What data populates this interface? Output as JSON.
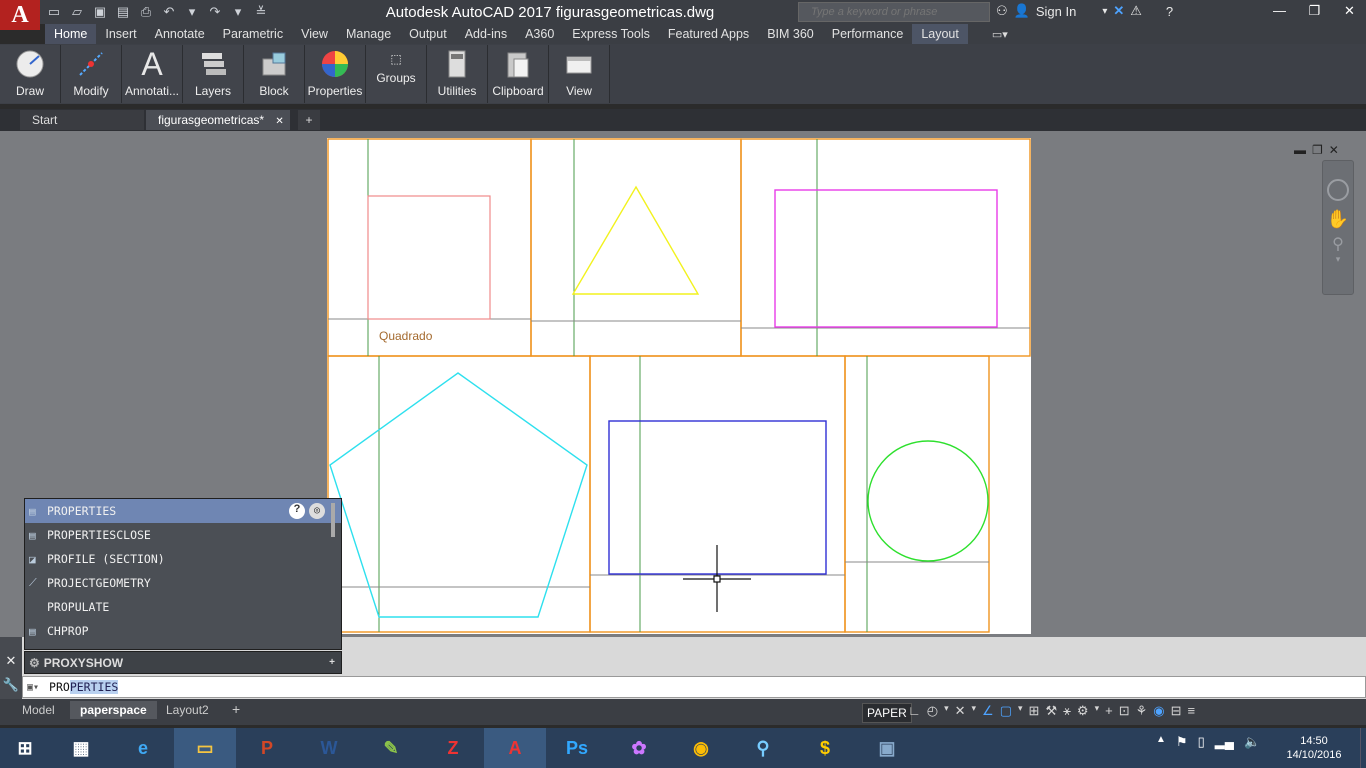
{
  "titlebar": {
    "app_logo": "A",
    "title": "Autodesk AutoCAD 2017    figurasgeometricas.dwg",
    "search_placeholder": "Type a keyword or phrase",
    "sign_in": "Sign In"
  },
  "ribbon_tabs": [
    "Home",
    "Insert",
    "Annotate",
    "Parametric",
    "View",
    "Manage",
    "Output",
    "Add-ins",
    "A360",
    "Express Tools",
    "Featured Apps",
    "BIM 360",
    "Performance",
    "Layout"
  ],
  "panels": [
    {
      "label": "Draw",
      "icon": "draw-icon"
    },
    {
      "label": "Modify",
      "icon": "modify-icon"
    },
    {
      "label": "Annotati...",
      "icon": "annotation-icon"
    },
    {
      "label": "Layers",
      "icon": "layers-icon"
    },
    {
      "label": "Block",
      "icon": "block-icon"
    },
    {
      "label": "Properties",
      "icon": "properties-icon"
    },
    {
      "label": "Groups",
      "icon": "groups-icon"
    },
    {
      "label": "Utilities",
      "icon": "utilities-icon"
    },
    {
      "label": "Clipboard",
      "icon": "clipboard-icon"
    },
    {
      "label": "View",
      "icon": "view-icon"
    }
  ],
  "file_tabs": {
    "start": "Start",
    "current": "figurasgeometricas*"
  },
  "drawing": {
    "label_quadrado": "Quadrado"
  },
  "autocomplete": {
    "items": [
      "PROPERTIES",
      "PROPERTIESCLOSE",
      "PROFILE (SECTION)",
      "PROJECTGEOMETRY",
      "PROPULATE",
      "CHPROP"
    ],
    "proxy": "PROXYSHOW"
  },
  "command_line": {
    "typed": "PRO",
    "completion": "PERTIES"
  },
  "layout_tabs": [
    "Model",
    "paperspace",
    "Layout2"
  ],
  "status": {
    "space": "PAPER"
  },
  "colors": {
    "viewport_border": "#f0931e",
    "title_bg": "#3b3e44",
    "ribbon_bg": "#3d4047",
    "paper": "#ffffff",
    "model_bg": "#7a7c80"
  },
  "taskbar": {
    "time": "14:50",
    "date": "14/10/2016"
  }
}
